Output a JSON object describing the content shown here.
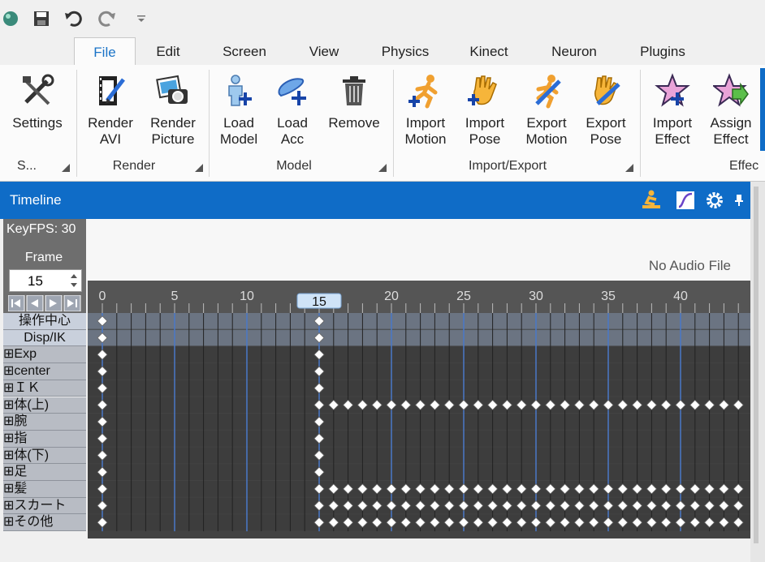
{
  "quick_access": {
    "icons": [
      "app-orb-icon",
      "save-icon",
      "undo-icon",
      "redo-icon",
      "customize-qat-icon"
    ]
  },
  "tabs": [
    {
      "label": "File",
      "active": true
    },
    {
      "label": "Edit"
    },
    {
      "label": "Screen"
    },
    {
      "label": "View"
    },
    {
      "label": "Physics"
    },
    {
      "label": "Kinect"
    },
    {
      "label": "Neuron"
    },
    {
      "label": "Plugins"
    }
  ],
  "ribbon": {
    "buttons": [
      {
        "line1": "Settings",
        "line2": "",
        "icon": "tools-icon"
      },
      {
        "line1": "Render",
        "line2": "AVI",
        "icon": "render-avi-icon"
      },
      {
        "line1": "Render",
        "line2": "Picture",
        "icon": "render-picture-icon"
      },
      {
        "line1": "Load",
        "line2": "Model",
        "icon": "load-model-icon"
      },
      {
        "line1": "Load",
        "line2": "Acc",
        "icon": "load-acc-icon"
      },
      {
        "line1": "Remove",
        "line2": "",
        "icon": "trash-icon"
      },
      {
        "line1": "Import",
        "line2": "Motion",
        "icon": "import-motion-icon"
      },
      {
        "line1": "Import",
        "line2": "Pose",
        "icon": "import-pose-icon"
      },
      {
        "line1": "Export",
        "line2": "Motion",
        "icon": "export-motion-icon"
      },
      {
        "line1": "Export",
        "line2": "Pose",
        "icon": "export-pose-icon"
      },
      {
        "line1": "Import",
        "line2": "Effect",
        "icon": "import-effect-icon"
      },
      {
        "line1": "Assign",
        "line2": "Effect",
        "icon": "assign-effect-icon"
      }
    ],
    "groups": [
      "S...",
      "Render",
      "Model",
      "Import/Export",
      "Effec"
    ]
  },
  "timeline": {
    "title": "Timeline",
    "keyfps": "KeyFPS: 30",
    "frame_label": "Frame",
    "frame_value": "15",
    "audio": "No Audio File",
    "current_frame": "15",
    "ruler_labels": [
      "0",
      "5",
      "10",
      "20",
      "25",
      "30",
      "35",
      "40"
    ],
    "rows": [
      {
        "label": "操作中心",
        "kind": "header",
        "keys": [
          0,
          15
        ]
      },
      {
        "label": "Disp/IK",
        "kind": "header",
        "keys": [
          0,
          15
        ]
      },
      {
        "label": "⊞Exp",
        "keys": [
          0,
          15
        ]
      },
      {
        "label": "⊞center",
        "keys": [
          0,
          15
        ]
      },
      {
        "label": "⊞ＩＫ",
        "keys": [
          0,
          15
        ]
      },
      {
        "label": "⊞体(上)",
        "keys": [
          0,
          15,
          16,
          17,
          18,
          19,
          20,
          21,
          22,
          23,
          24,
          25,
          26,
          27,
          28,
          29,
          30,
          31,
          32,
          33,
          34,
          35,
          36,
          37,
          38,
          39,
          40,
          41,
          42,
          43,
          44,
          45
        ]
      },
      {
        "label": "⊞腕",
        "keys": [
          0,
          15
        ]
      },
      {
        "label": "⊞指",
        "keys": [
          0,
          15
        ]
      },
      {
        "label": "⊞体(下)",
        "keys": [
          0,
          15
        ]
      },
      {
        "label": "⊞足",
        "keys": [
          0,
          15
        ]
      },
      {
        "label": "⊞髪",
        "keys": [
          0,
          15,
          16,
          17,
          18,
          19,
          20,
          21,
          22,
          23,
          24,
          25,
          26,
          27,
          28,
          29,
          30,
          31,
          32,
          33,
          34,
          35,
          36,
          37,
          38,
          39,
          40,
          41,
          42,
          43,
          44,
          45
        ]
      },
      {
        "label": "⊞スカート",
        "keys": [
          0,
          15,
          16,
          17,
          18,
          19,
          20,
          21,
          22,
          23,
          24,
          25,
          26,
          27,
          28,
          29,
          30,
          31,
          32,
          33,
          34,
          35,
          36,
          37,
          38,
          39,
          40,
          41,
          42,
          43,
          44,
          45
        ]
      },
      {
        "label": "⊞その他",
        "keys": [
          0,
          15,
          16,
          17,
          18,
          19,
          20,
          21,
          22,
          23,
          24,
          25,
          26,
          27,
          28,
          29,
          30,
          31,
          32,
          33,
          34,
          35,
          36,
          37,
          38,
          39,
          40,
          41,
          42,
          43,
          44,
          45
        ]
      }
    ]
  },
  "colors": {
    "accent": "#0f6cc7",
    "grid_bg": "#434343",
    "header_row": "#6b7482",
    "key": "#ffffff"
  }
}
